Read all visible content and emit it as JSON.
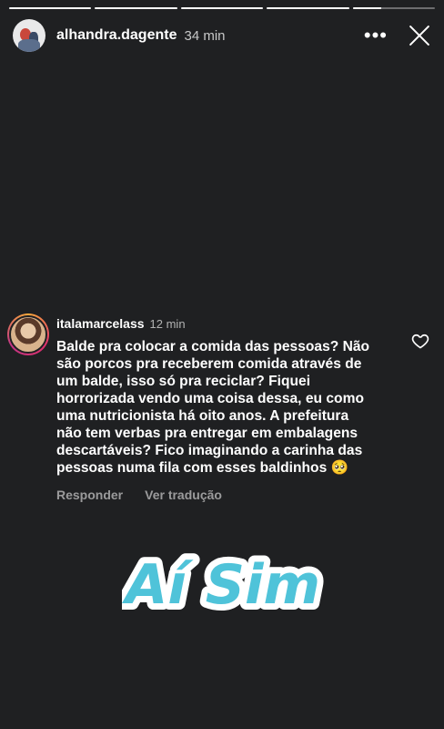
{
  "progress": [
    1,
    1,
    1,
    1,
    0.35
  ],
  "header": {
    "username": "alhandra.dagente",
    "time": "34 min",
    "more_icon": "more-horizontal-icon",
    "close_icon": "close-icon"
  },
  "comment": {
    "username": "italamarcelass",
    "time": "12 min",
    "text": "Balde pra colocar a comida das pessoas? Não são porcos pra receberem comida através de um balde, isso só pra reciclar? Fiquei horrorizada vendo uma coisa dessa, eu como uma nutricionista há oito anos. A prefeitura não tem verbas pra entregar em embalagens descartáveis? Fico imaginando a carinha das pessoas numa fila com esses baldinhos 🥺",
    "reply_label": "Responder",
    "translate_label": "Ver tradução",
    "like_icon": "heart-outline-icon"
  },
  "sticker": {
    "text": "Aí Sim",
    "fill_color": "#4fc3d9",
    "outline_color": "#ffffff"
  }
}
